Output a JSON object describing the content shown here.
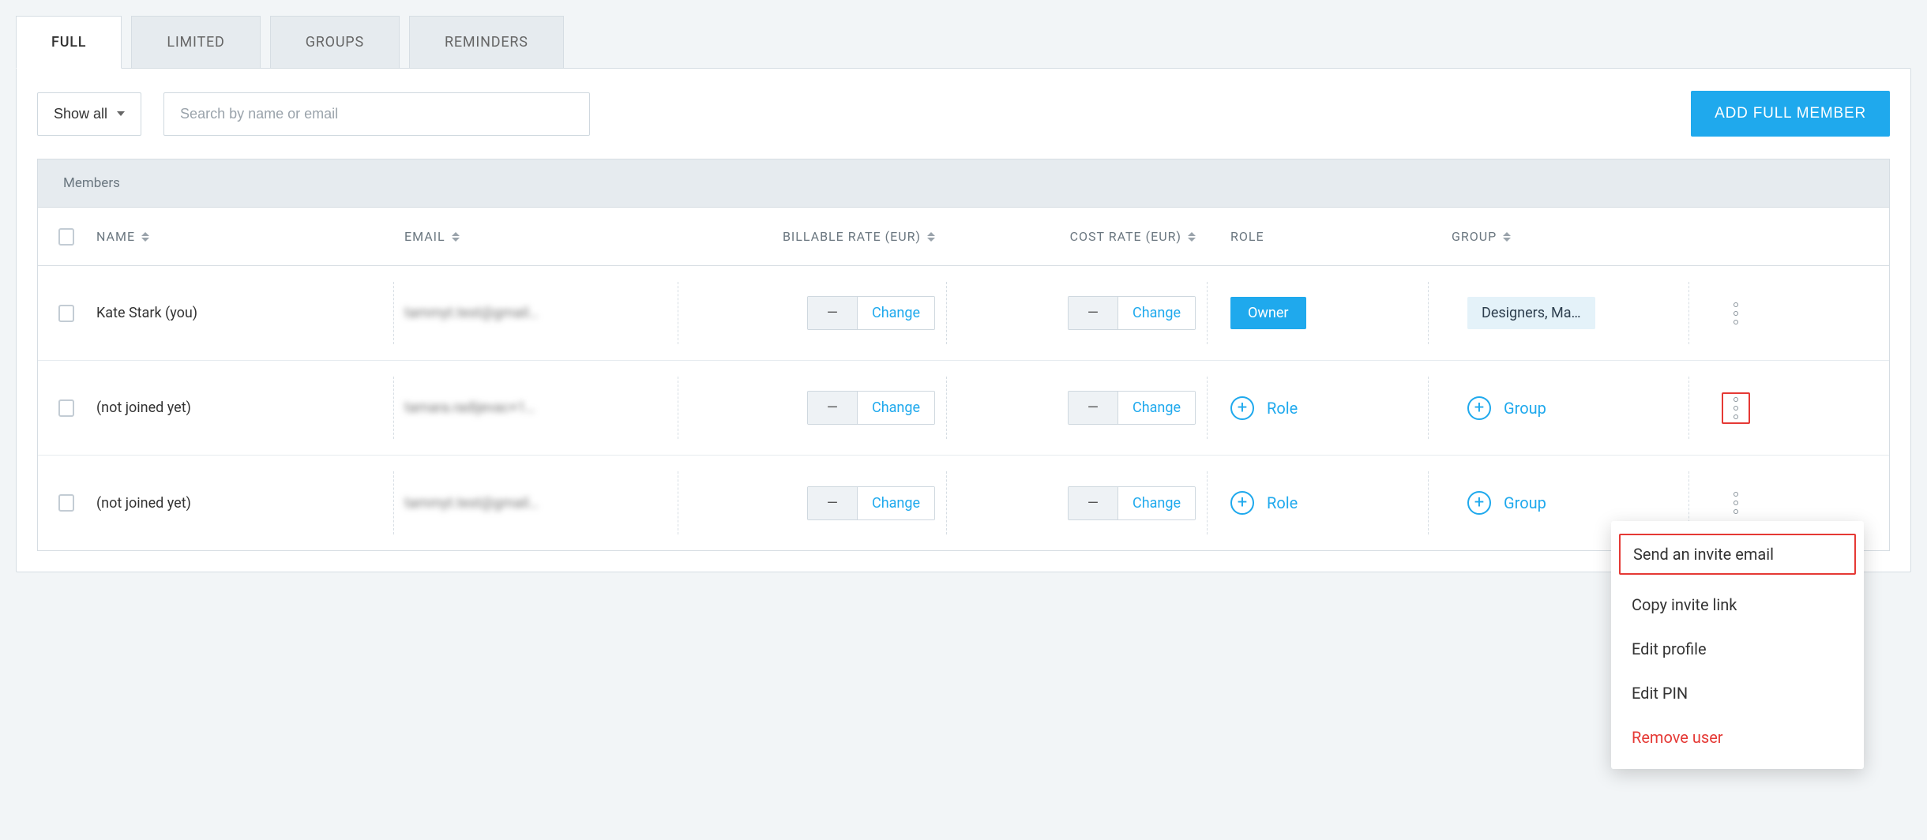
{
  "tabs": {
    "full": "FULL",
    "limited": "LIMITED",
    "groups": "GROUPS",
    "reminders": "REMINDERS"
  },
  "toolbar": {
    "filter_label": "Show all",
    "search_placeholder": "Search by name or email",
    "add_button": "ADD FULL MEMBER"
  },
  "table": {
    "title": "Members",
    "headers": {
      "name": "NAME",
      "email": "EMAIL",
      "billable": "BILLABLE RATE (EUR)",
      "cost": "COST RATE (EUR)",
      "role": "ROLE",
      "group": "GROUP"
    },
    "rate_change_label": "Change",
    "rate_empty": "—",
    "role_add_label": "Role",
    "group_add_label": "Group",
    "rows": [
      {
        "name": "Kate Stark (you)",
        "email": "tammyt.test@gmail…",
        "role_badge": "Owner",
        "group_chip": "Designers, Ma…"
      },
      {
        "name": "(not joined yet)",
        "email": "tamara.radijevac+1…"
      },
      {
        "name": "(not joined yet)",
        "email": "tammyt.test@gmail…"
      }
    ]
  },
  "menu": {
    "send_invite": "Send an invite email",
    "copy_link": "Copy invite link",
    "edit_profile": "Edit profile",
    "edit_pin": "Edit PIN",
    "remove_user": "Remove user"
  }
}
